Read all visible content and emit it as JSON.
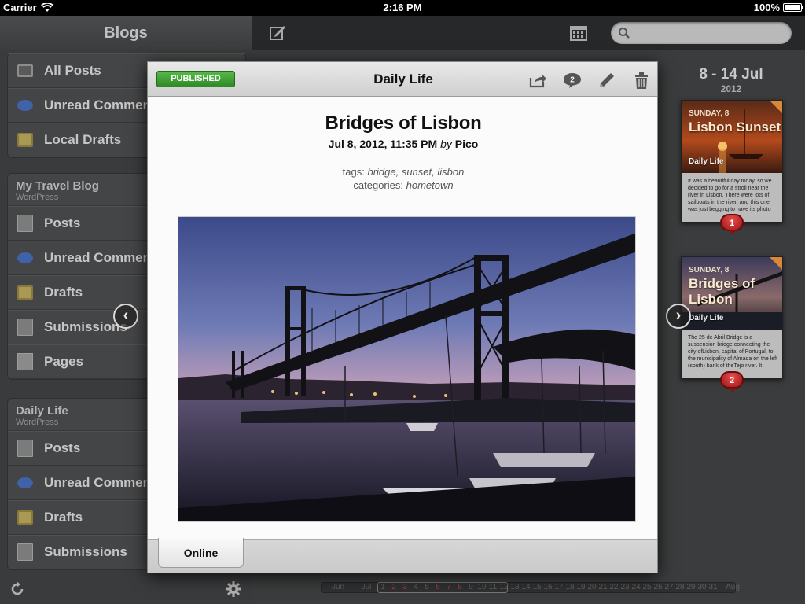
{
  "status_bar": {
    "carrier": "Carrier",
    "time": "2:16 PM",
    "battery": "100%"
  },
  "sidebar": {
    "title": "Blogs",
    "top_items": [
      {
        "label": "All Posts",
        "icon": "monitor-icon"
      },
      {
        "label": "Unread Comments",
        "icon": "comment-bubble-icon"
      },
      {
        "label": "Local Drafts",
        "icon": "local-draft-icon"
      }
    ],
    "blogs": [
      {
        "name": "My Travel Blog",
        "platform": "WordPress",
        "items": [
          {
            "label": "Posts",
            "icon": "posts-icon"
          },
          {
            "label": "Unread Comments",
            "icon": "comment-bubble-icon"
          },
          {
            "label": "Drafts",
            "icon": "drafts-icon"
          },
          {
            "label": "Submissions",
            "icon": "submissions-icon"
          },
          {
            "label": "Pages",
            "icon": "page-icon"
          }
        ]
      },
      {
        "name": "Daily Life",
        "platform": "WordPress",
        "items": [
          {
            "label": "Posts",
            "icon": "posts-icon"
          },
          {
            "label": "Unread Comments",
            "icon": "comment-bubble-icon"
          },
          {
            "label": "Drafts",
            "icon": "drafts-icon"
          },
          {
            "label": "Submissions",
            "icon": "submissions-icon"
          }
        ]
      }
    ],
    "footer": {
      "refresh_icon": "refresh-icon",
      "settings_icon": "gear-icon"
    }
  },
  "toolbar": {
    "compose_icon": "compose-icon",
    "calendar_icon": "calendar-icon",
    "search_placeholder": ""
  },
  "week": {
    "range": "8 - 14 Jul",
    "year": "2012"
  },
  "cards": [
    {
      "day": "SUNDAY, 8",
      "title": "Lisbon Sunset",
      "blog": "Daily Life",
      "excerpt": "It was a beautiful day today, so we decided to go for a stroll near the river in Lisbon. There were lots of sailboats in the river, and this one was just begging to have its photo",
      "comments": "1"
    },
    {
      "day": "SUNDAY, 8",
      "title": "Bridges of Lisbon",
      "blog": "Daily Life",
      "excerpt": "The 25 de Abril Bridge is a suspension bridge connecting the city ofLisbon, capital of Portugal, to the municipality of Almada on the left (south) bank of theTejo river. It",
      "comments": "2"
    }
  ],
  "timeline": {
    "months": [
      "Jun",
      "Jul",
      "Aug"
    ],
    "days": [
      "1",
      "2",
      "3",
      "4",
      "5",
      "6",
      "7",
      "8",
      "9",
      "10",
      "11",
      "12",
      "13",
      "14",
      "15",
      "16",
      "17",
      "18",
      "19",
      "20",
      "21",
      "22",
      "23",
      "24",
      "25",
      "26",
      "27",
      "28",
      "29",
      "30",
      "31"
    ],
    "highlight_days": [
      "2",
      "3",
      "6",
      "7",
      "8"
    ],
    "selected_range": "8 - 14"
  },
  "post": {
    "status": "PUBLISHED",
    "blog": "Daily Life",
    "title": "Bridges of Lisbon",
    "date": "Jul 8, 2012, 11:35 PM",
    "by": "by",
    "author": "Pico",
    "tags_label": "tags:",
    "tags": "bridge, sunset, lisbon",
    "categories_label": "categories:",
    "categories": "hometown",
    "comment_count": "2",
    "image_subject": "suspension bridge over marina at sunset",
    "tab": "Online"
  },
  "colors": {
    "published_green": "#3a9a2f",
    "badge_red": "#c42424",
    "card_accent": "#d9883a"
  }
}
